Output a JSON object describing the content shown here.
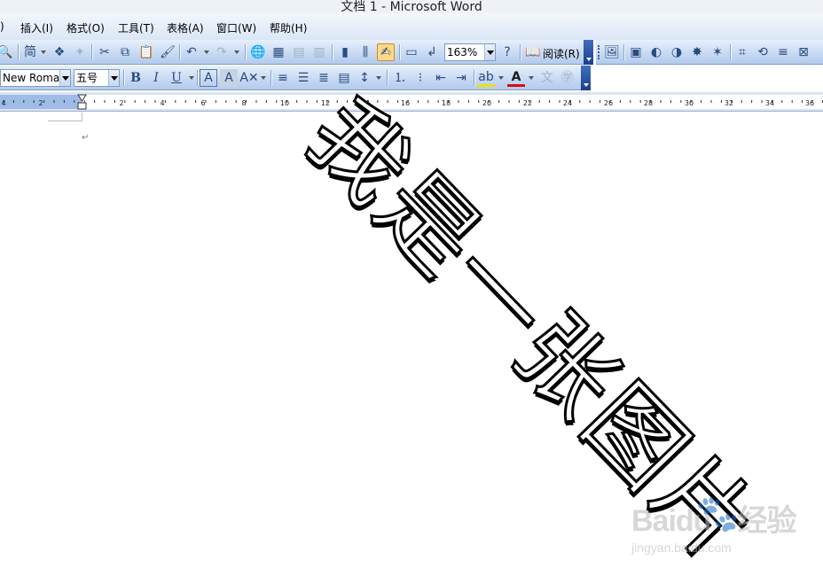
{
  "window": {
    "title": "文档 1 - Microsoft Word"
  },
  "menu": {
    "items": [
      {
        "label": ")"
      },
      {
        "label": "插入(I)"
      },
      {
        "label": "格式(O)"
      },
      {
        "label": "工具(T)"
      },
      {
        "label": "表格(A)"
      },
      {
        "label": "窗口(W)"
      },
      {
        "label": "帮助(H)"
      }
    ]
  },
  "toolbar_standard": {
    "zoom_value": "163%",
    "read_label": "阅读(R)",
    "icons": [
      "print-preview-icon",
      "simplified-chinese-icon",
      "traditional-chinese-icon",
      "research-icon",
      "cut-icon",
      "copy-icon",
      "paste-icon",
      "format-painter-icon",
      "undo-icon",
      "redo-icon",
      "hyperlink-icon",
      "tables-borders-icon",
      "insert-table-icon",
      "insert-excel-icon",
      "columns-icon",
      "drawing-icon",
      "document-map-icon",
      "show-hide-icon",
      "help-icon",
      "read-icon"
    ]
  },
  "toolbar_picture": {
    "icons": [
      "insert-picture-icon",
      "color-icon",
      "more-contrast-icon",
      "less-contrast-icon",
      "more-brightness-icon",
      "less-brightness-icon",
      "crop-icon",
      "rotate-left-icon",
      "line-style-icon",
      "compress-icon"
    ]
  },
  "toolbar_formatting": {
    "font_name": "New Roman",
    "font_size": "五号",
    "bold_label": "B",
    "italic_label": "I",
    "underline_label": "U",
    "char_border_label": "A",
    "char_shading_label": "A",
    "font_color_label": "A",
    "font_color": "#d01010",
    "highlight_color": "#f0e000"
  },
  "ruler": {
    "numbers": [
      "4",
      "2",
      "2",
      "4",
      "6",
      "8",
      "10",
      "12",
      "14",
      "16",
      "18",
      "20",
      "22",
      "24",
      "26",
      "28",
      "30",
      "32",
      "34",
      "36"
    ]
  },
  "document": {
    "paragraph_mark": "↵",
    "wordart_text": "我是一张图片"
  },
  "watermark": {
    "brand": "Baidu",
    "brand_cn": "经验",
    "url": "jingyan.baidu.com"
  }
}
